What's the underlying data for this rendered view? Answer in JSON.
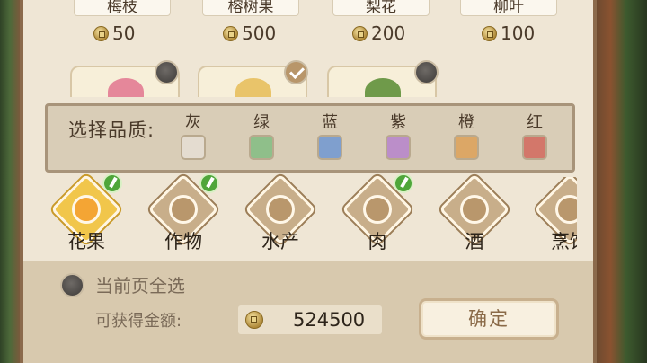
{
  "items": [
    {
      "name": "梅枝",
      "price": "50",
      "selected": false
    },
    {
      "name": "榕树果",
      "price": "500",
      "selected": true
    },
    {
      "name": "梨花",
      "price": "200",
      "selected": false
    },
    {
      "name": "柳叶",
      "price": "100",
      "selected": false
    }
  ],
  "quality": {
    "label": "选择品质:",
    "options": [
      {
        "name": "灰",
        "color": "#e4dcd0"
      },
      {
        "name": "绿",
        "color": "#8fbf8a"
      },
      {
        "name": "蓝",
        "color": "#7f9fce"
      },
      {
        "name": "紫",
        "color": "#bb8ec9"
      },
      {
        "name": "橙",
        "color": "#dca766"
      },
      {
        "name": "红",
        "color": "#d3776a"
      }
    ]
  },
  "categories": [
    {
      "label": "花果",
      "icon": "fruit-icon",
      "active": true,
      "badge": true
    },
    {
      "label": "作物",
      "icon": "wheat-icon",
      "active": false,
      "badge": true
    },
    {
      "label": "水产",
      "icon": "crab-icon",
      "active": false,
      "badge": false
    },
    {
      "label": "肉",
      "icon": "meat-icon",
      "active": false,
      "badge": true
    },
    {
      "label": "酒",
      "icon": "wine-jar-icon",
      "active": false,
      "badge": false
    },
    {
      "label": "烹饪",
      "icon": "cooking-icon",
      "active": false,
      "badge": false
    }
  ],
  "footer": {
    "select_all_label": "当前页全选",
    "gold_label": "可获得金额:",
    "gold_value": "524500",
    "confirm_label": "确定"
  }
}
